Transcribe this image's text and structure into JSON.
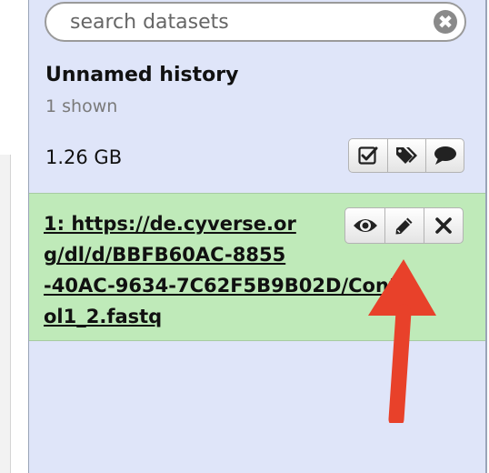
{
  "search": {
    "placeholder": "search datasets",
    "clear_glyph": "✖"
  },
  "history": {
    "name": "Unnamed history",
    "shown_count": "1 shown",
    "size": "1.26 GB",
    "actions": [
      {
        "icon": "checkbox-icon"
      },
      {
        "icon": "tags-icon"
      },
      {
        "icon": "comment-icon"
      }
    ]
  },
  "dataset": {
    "title_lines": [
      "1: https://de.cyverse.or",
      "g/dl/d/BBFB60AC-8855",
      "-40AC-9634-7C62F5B9B02D/Contr",
      "ol1_2.fastq"
    ],
    "state_color": "#bfeab9",
    "actions": [
      {
        "icon": "eye-icon"
      },
      {
        "icon": "pencil-icon"
      },
      {
        "icon": "delete-icon"
      }
    ]
  },
  "annotation": {
    "arrow_color": "#e8412a"
  },
  "colors": {
    "panel_bg": "#dfe5f9",
    "ok_bg": "#bfeab9",
    "center_bg": "#f2f2f2"
  }
}
